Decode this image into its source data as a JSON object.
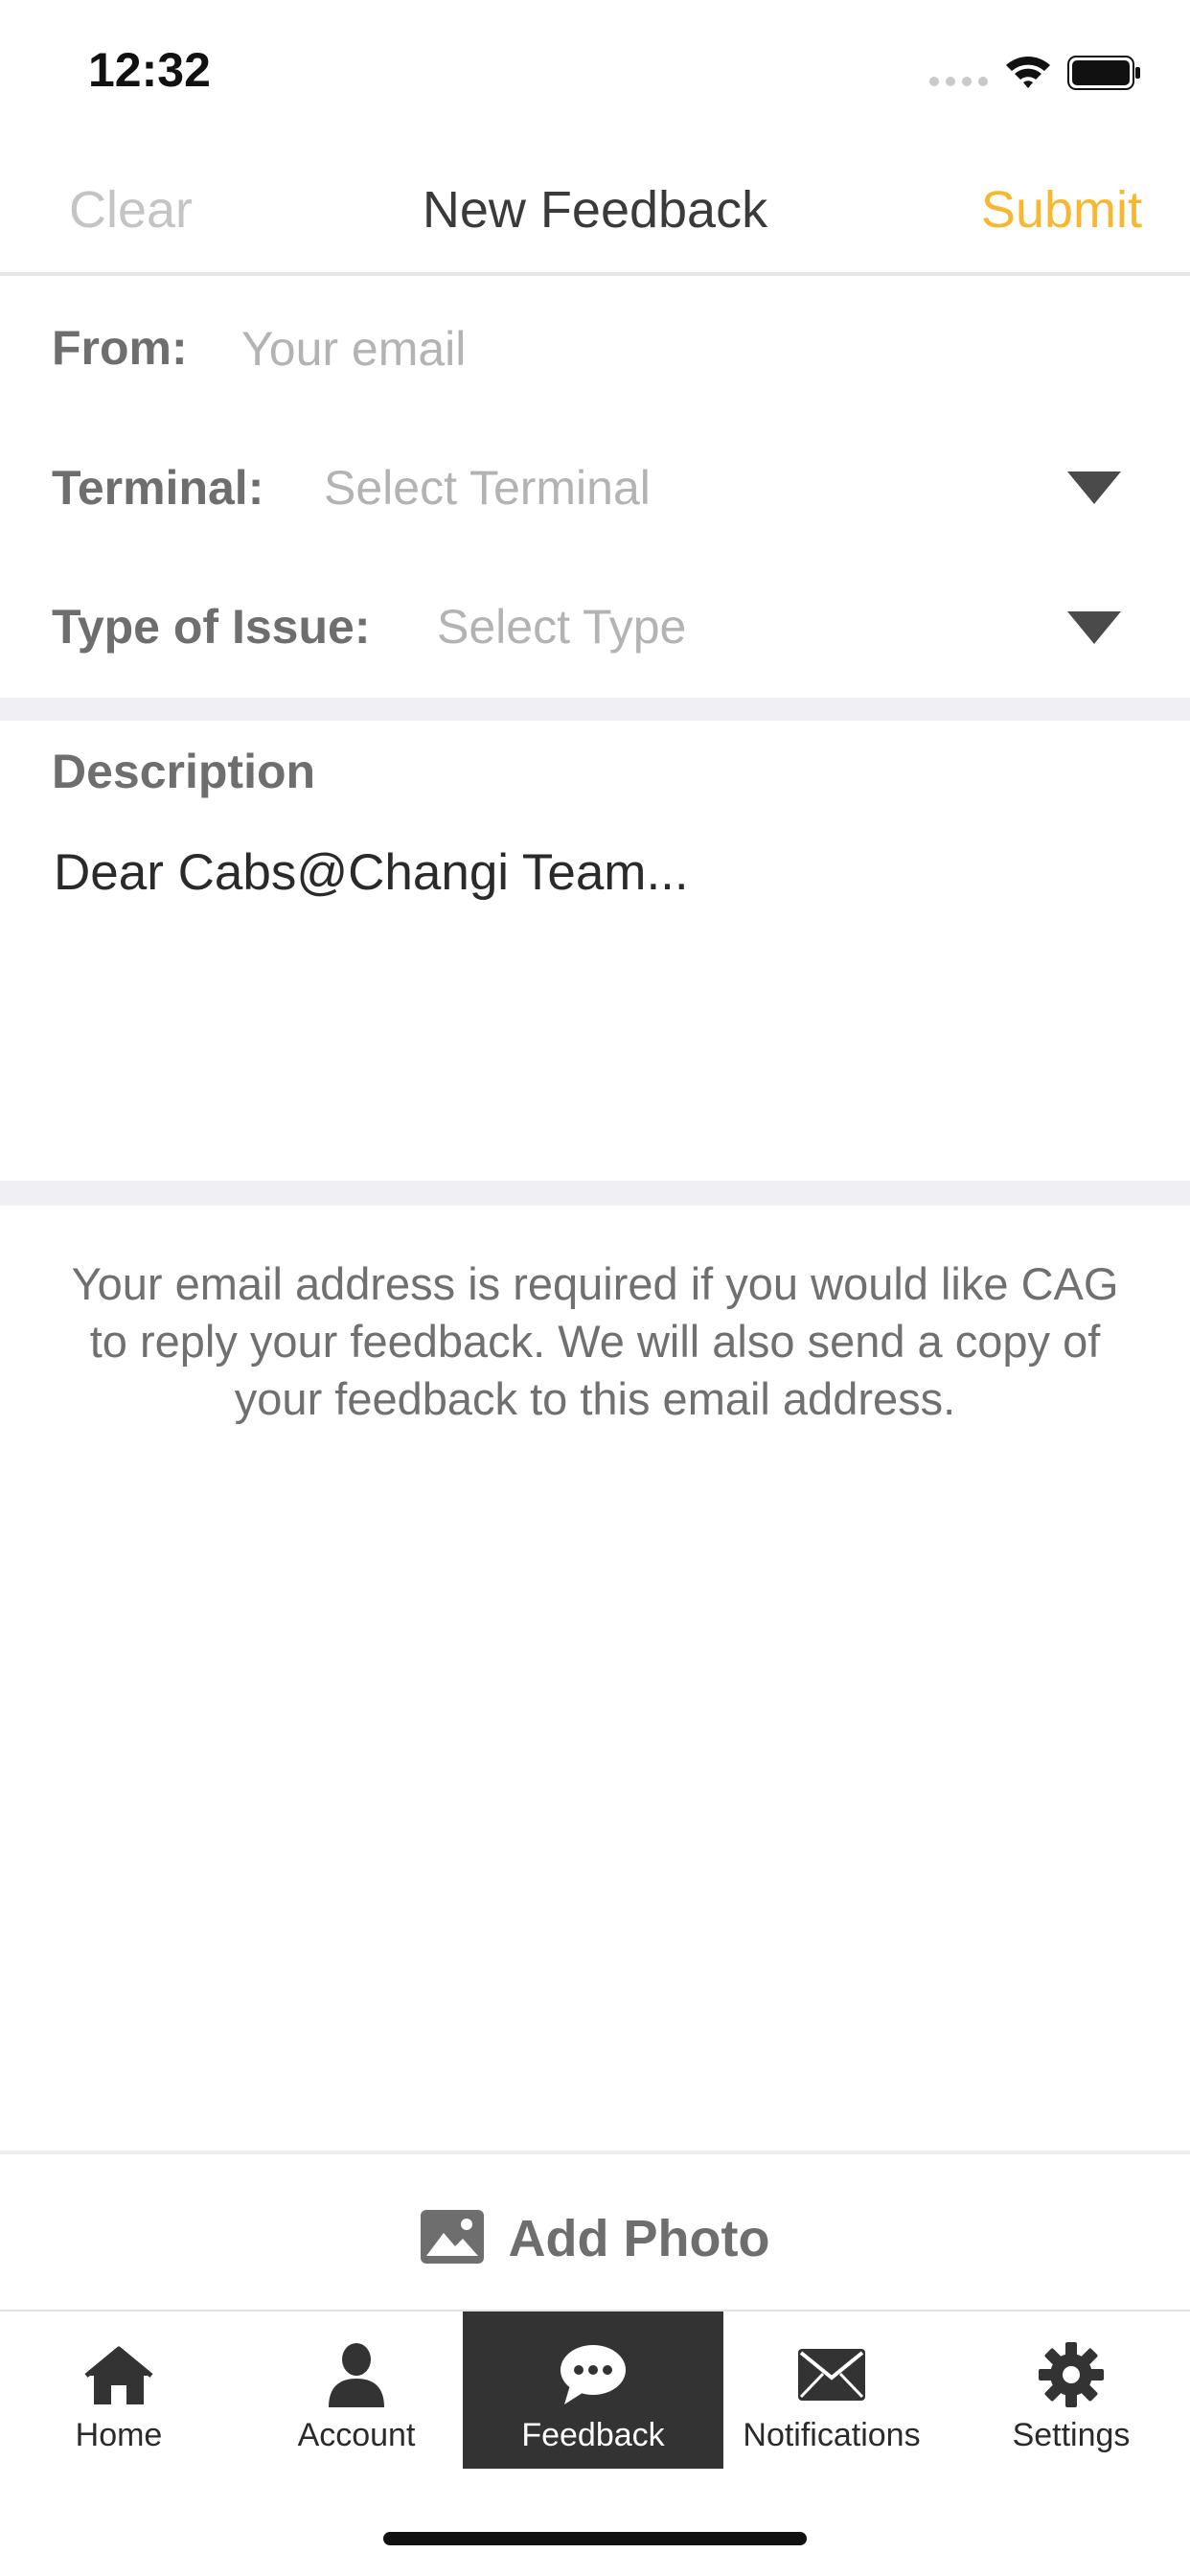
{
  "status_bar": {
    "time": "12:32"
  },
  "nav": {
    "clear_label": "Clear",
    "title": "New Feedback",
    "submit_label": "Submit",
    "submit_color": "#f7b731"
  },
  "form": {
    "from_label": "From:",
    "from_placeholder": "Your email",
    "terminal_label": "Terminal:",
    "terminal_placeholder": "Select Terminal",
    "type_label": "Type of Issue:",
    "type_placeholder": "Select Type",
    "description_label": "Description",
    "description_text": "Dear Cabs@Changi Team..."
  },
  "info_text": "Your email address is required if you would like CAG to reply your feedback. We will also send a copy of your feedback to this email address.",
  "add_photo": {
    "label": "Add Photo",
    "icon": "image-icon"
  },
  "tabs": [
    {
      "label": "Home",
      "icon": "home-icon",
      "active": false
    },
    {
      "label": "Account",
      "icon": "account-icon",
      "active": false
    },
    {
      "label": "Feedback",
      "icon": "chat-bubble-icon",
      "active": true
    },
    {
      "label": "Notifications",
      "icon": "envelope-icon",
      "active": false
    },
    {
      "label": "Settings",
      "icon": "gear-icon",
      "active": false
    }
  ]
}
